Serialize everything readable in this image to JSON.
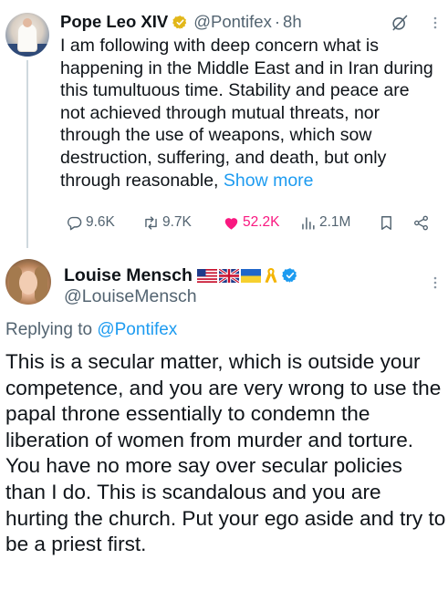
{
  "tweet": {
    "author_name": "Pope Leo XIV",
    "verified_badge": "gold-verified-badge",
    "handle": "@Pontifex",
    "separator": "·",
    "time": "8h",
    "text": "I am following with deep concern what is happening in the Middle East and in Iran during this tumultuous time. Stability and peace are not achieved through mutual threats, nor through the use of weapons, which sow destruction, suffering, and death, but only through reasonable,",
    "show_more": "Show more",
    "stats": {
      "replies": "9.6K",
      "reposts": "9.7K",
      "likes": "52.2K",
      "views": "2.1M"
    }
  },
  "reply": {
    "author_name": "Louise Mensch",
    "handle": "@LouiseMensch",
    "name_emoji": [
      "us-flag",
      "uk-flag",
      "ukraine-flag",
      "yellow-ribbon"
    ],
    "verified_badge": "blue-verified-badge",
    "replying_prefix": "Replying to",
    "replying_to": "@Pontifex",
    "text": "This is a secular matter, which is outside your competence, and you are very wrong to use the papal throne essentially to condemn the liberation of women from murder and torture. You have no more say over secular policies than I do. This is scandalous and you are hurting the church. Put your ego aside and try to be a priest first."
  },
  "colors": {
    "link": "#1d9bf0",
    "secondary_text": "#536471",
    "like_active": "#f91880",
    "verified_gold": "#e2b719",
    "verified_blue": "#1d9bf0"
  }
}
